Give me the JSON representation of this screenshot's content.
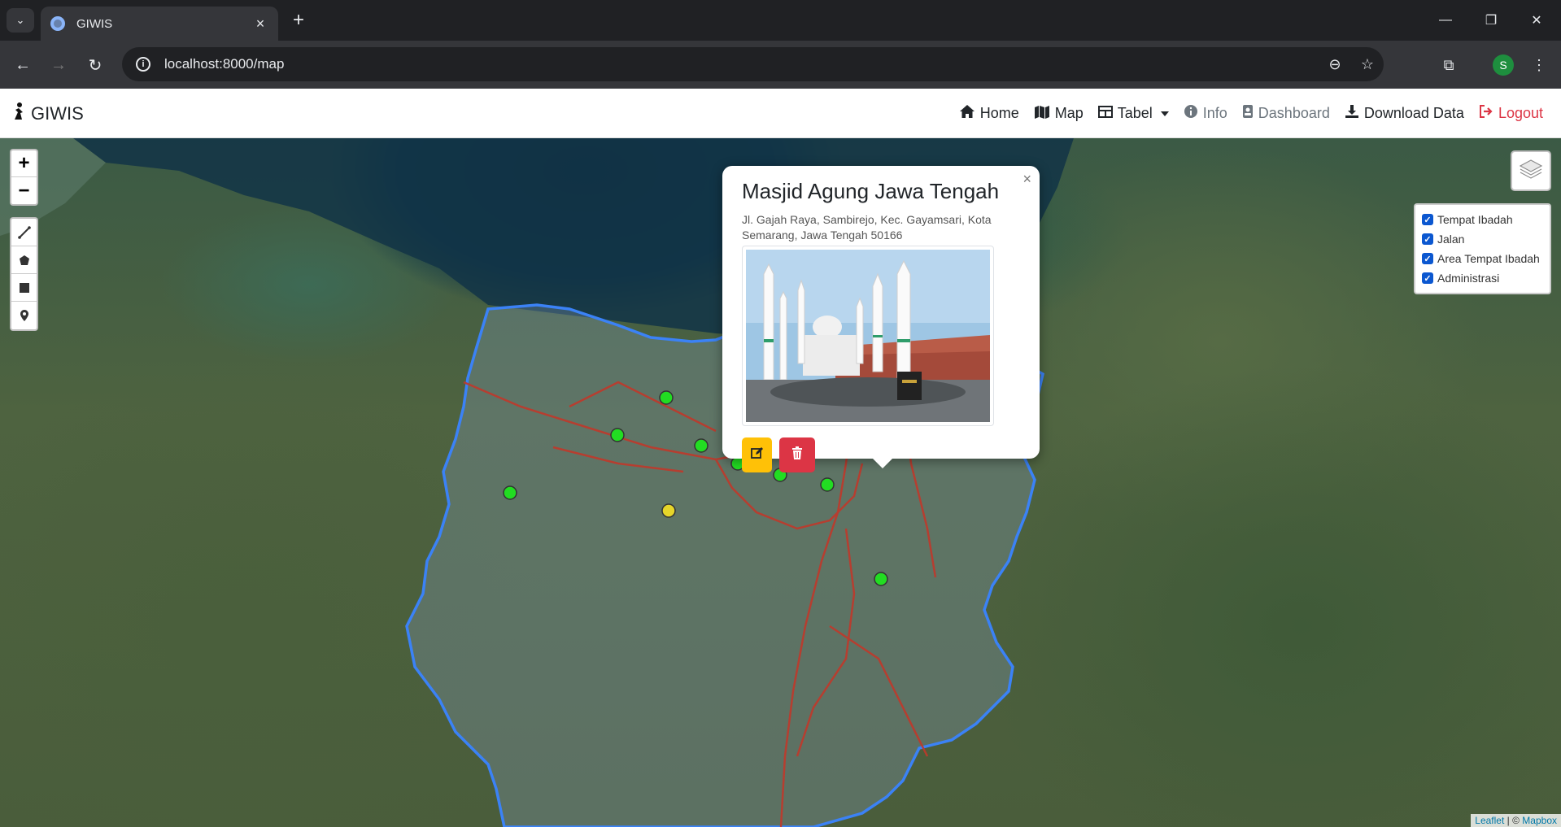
{
  "browser": {
    "tab_title": "GIWIS",
    "url": "localhost:8000/map",
    "profile_initial": "S"
  },
  "navbar": {
    "brand": "GIWIS",
    "links": {
      "home": "Home",
      "map": "Map",
      "tabel": "Tabel",
      "info": "Info",
      "dashboard": "Dashboard",
      "download": "Download Data",
      "logout": "Logout"
    }
  },
  "map": {
    "zoom_in": "+",
    "zoom_out": "−",
    "layers": [
      "Tempat Ibadah",
      "Jalan",
      "Area Tempat Ibadah",
      "Administrasi"
    ],
    "layers_checked": [
      true,
      true,
      true,
      true
    ],
    "popup": {
      "title": "Masjid Agung Jawa Tengah",
      "address": "Jl. Gajah Raya, Sambirejo, Kec. Gayamsari, Kota Semarang, Jawa Tengah 50166",
      "close": "×"
    },
    "attribution": {
      "leaflet": "Leaflet",
      "separator": "| ©",
      "mapbox": "Mapbox"
    },
    "marker_colors": {
      "green": "#22dd22",
      "yellow": "#e6d52a",
      "red": "#ee2222",
      "cyan": "#33d6e0",
      "brown": "#9b5a1a"
    }
  }
}
